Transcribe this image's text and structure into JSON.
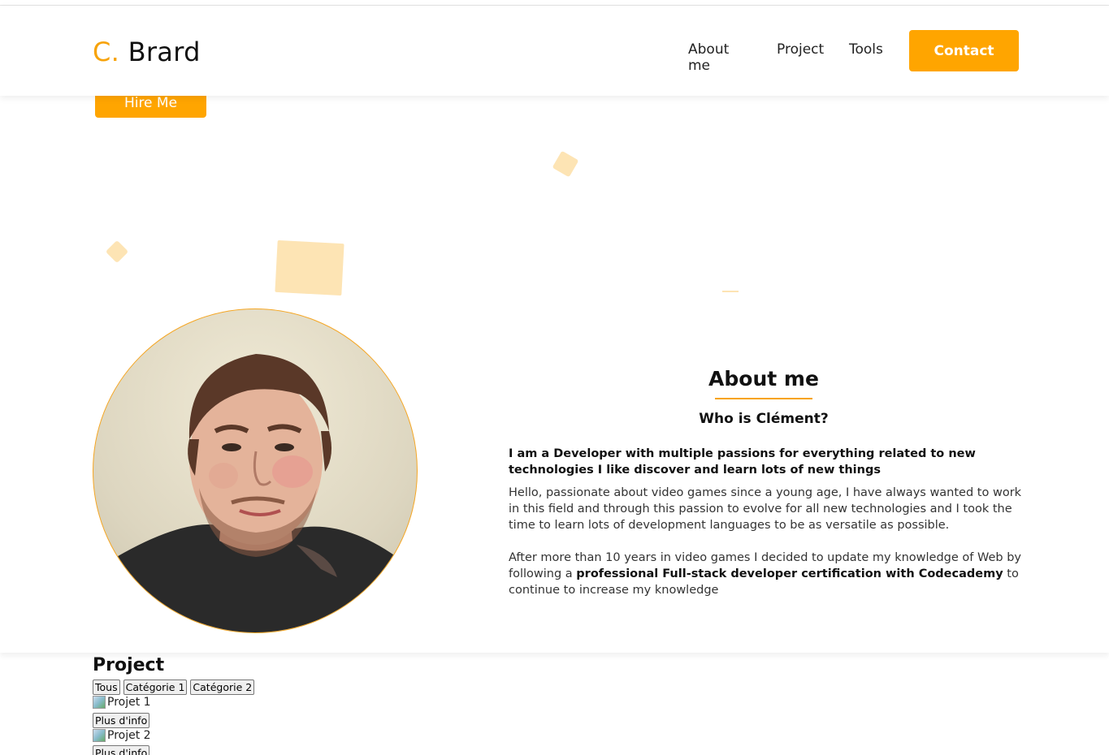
{
  "header": {
    "logo_initial": "C.",
    "logo_name": " Brard",
    "nav": {
      "about": "About me",
      "project": "Project",
      "tools": "Tools"
    },
    "contact_label": "Contact"
  },
  "hero": {
    "hire_label": "Hire Me"
  },
  "about": {
    "title": "About me",
    "subtitle": "Who is Clément?",
    "lead": "I am a Developer with multiple passions for everything related to new technologies I like discover and learn lots of new things",
    "p1": "Hello, passionate about video games since a young age, I have always wanted to work in this field and through this passion to evolve for all new technologies and I took the time to learn lots of development languages to be as versatile as possible.",
    "p2_start": "After more than 10 years in video games I decided to update my knowledge of Web by following a ",
    "p2_bold": "professional Full-stack developer certification with Codecademy",
    "p2_end": " to continue to increase my knowledge"
  },
  "project": {
    "title": "Project",
    "filters": [
      "Tous",
      "Catégorie 1",
      "Catégorie 2"
    ],
    "items": [
      {
        "alt": "Projet 1",
        "more": "Plus d'info"
      },
      {
        "alt": "Projet 2",
        "more": "Plus d'info"
      }
    ]
  },
  "colors": {
    "accent": "#ffa500",
    "accent_light": "#fde4b4"
  }
}
